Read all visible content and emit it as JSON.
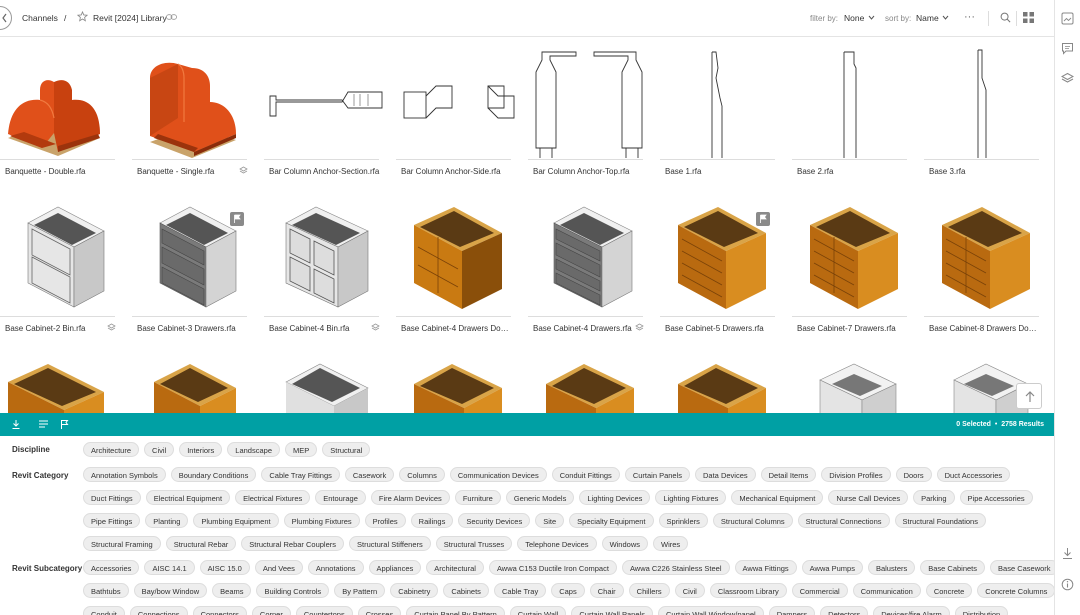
{
  "topbar": {
    "crumb_channels": "Channels",
    "crumb_sep": "/",
    "library_title": "Revit [2024] Library",
    "filter_label": "filter by:",
    "filter_value": "None",
    "sort_label": "sort by:",
    "sort_value": "Name",
    "more": "···"
  },
  "grid": {
    "row1": [
      "Banquette - Double.rfa",
      "Banquette - Single.rfa",
      "Bar Column Anchor-Section.rfa",
      "Bar Column Anchor-Side.rfa",
      "Bar Column Anchor-Top.rfa",
      "Base 1.rfa",
      "Base 2.rfa",
      "Base 3.rfa"
    ],
    "row2": [
      "Base Cabinet-2 Bin.rfa",
      "Base Cabinet-3 Drawers.rfa",
      "Base Cabinet-4 Bin.rfa",
      "Base Cabinet-4 Drawers Double...",
      "Base Cabinet-4 Drawers.rfa",
      "Base Cabinet-5 Drawers.rfa",
      "Base Cabinet-7 Drawers.rfa",
      "Base Cabinet-8 Drawers Double..."
    ]
  },
  "status": {
    "selected": "0 Selected",
    "results": "2758 Results"
  },
  "filters": {
    "discipline_label": "Discipline",
    "discipline": [
      "Architecture",
      "Civil",
      "Interiors",
      "Landscape",
      "MEP",
      "Structural"
    ],
    "category_label": "Revit Category",
    "category_row1": [
      "Annotation Symbols",
      "Boundary Conditions",
      "Cable Tray Fittings",
      "Casework",
      "Columns",
      "Communication Devices",
      "Conduit Fittings",
      "Curtain Panels",
      "Data Devices",
      "Detail Items",
      "Division Profiles",
      "Doors",
      "Duct Accessories"
    ],
    "category_row2": [
      "Duct Fittings",
      "Electrical Equipment",
      "Electrical Fixtures",
      "Entourage",
      "Fire Alarm Devices",
      "Furniture",
      "Generic Models",
      "Lighting Devices",
      "Lighting Fixtures",
      "Mechanical Equipment",
      "Nurse Call Devices",
      "Parking",
      "Pipe Accessories"
    ],
    "category_row3": [
      "Pipe Fittings",
      "Planting",
      "Plumbing Equipment",
      "Plumbing Fixtures",
      "Profiles",
      "Railings",
      "Security Devices",
      "Site",
      "Specialty Equipment",
      "Sprinklers",
      "Structural Columns",
      "Structural Connections",
      "Structural Foundations"
    ],
    "category_row4": [
      "Structural Framing",
      "Structural Rebar",
      "Structural Rebar Couplers",
      "Structural Stiffeners",
      "Structural Trusses",
      "Telephone Devices",
      "Windows",
      "Wires"
    ],
    "subcategory_label": "Revit Subcategory",
    "subcategory_row1": [
      "Accessories",
      "AISC 14.1",
      "AISC 15.0",
      "And Vees",
      "Annotations",
      "Appliances",
      "Architectural",
      "Awwa C153 Ductile Iron Compact",
      "Awwa C226 Stainless Steel",
      "Awwa Fittings",
      "Awwa Pumps",
      "Balusters",
      "Base Cabinets",
      "Base Casework"
    ],
    "subcategory_row2": [
      "Bathtubs",
      "Bay/bow Window",
      "Beams",
      "Building Controls",
      "By Pattern",
      "Cabinetry",
      "Cabinets",
      "Cable Tray",
      "Caps",
      "Chair",
      "Chillers",
      "Civil",
      "Classroom Library",
      "Commercial",
      "Communication",
      "Concrete",
      "Concrete Columns"
    ],
    "subcategory_row3": [
      "Conduit",
      "Connections",
      "Connectors",
      "Corner",
      "Countertops",
      "Crosses",
      "Curtain Panel By Pattern",
      "Curtain Wall",
      "Curtain Wall Panels",
      "Curtain Wall Window/panel",
      "Dampers",
      "Detectors",
      "Devices/fire Alarm",
      "Distribution"
    ]
  },
  "colors": {
    "accent": "#00a0a4",
    "chip_bg": "#eeeeee",
    "orange": "#e0501a",
    "wood": "#c97a12"
  }
}
